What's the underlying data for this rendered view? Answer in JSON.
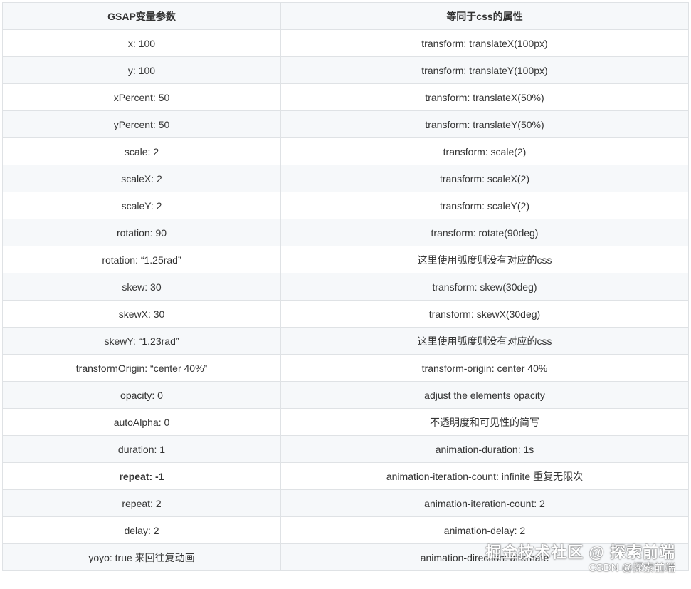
{
  "table": {
    "headers": [
      "GSAP变量参数",
      "等同于css的属性"
    ],
    "rows": [
      {
        "param": "x: 100",
        "css": "transform: translateX(100px)"
      },
      {
        "param": "y: 100",
        "css": "transform: translateY(100px)"
      },
      {
        "param": "xPercent: 50",
        "css": "transform: translateX(50%)"
      },
      {
        "param": "yPercent: 50",
        "css": "transform: translateY(50%)"
      },
      {
        "param": "scale: 2",
        "css": "transform: scale(2)"
      },
      {
        "param": "scaleX: 2",
        "css": "transform: scaleX(2)"
      },
      {
        "param": "scaleY: 2",
        "css": "transform: scaleY(2)"
      },
      {
        "param": "rotation: 90",
        "css": "transform: rotate(90deg)"
      },
      {
        "param": "rotation: “1.25rad”",
        "css": "这里使用弧度则没有对应的css"
      },
      {
        "param": "skew: 30",
        "css": "transform: skew(30deg)"
      },
      {
        "param": "skewX: 30",
        "css": "transform: skewX(30deg)"
      },
      {
        "param": "skewY: “1.23rad”",
        "css": "这里使用弧度则没有对应的css"
      },
      {
        "param": "transformOrigin: “center 40%”",
        "css": "transform-origin: center 40%"
      },
      {
        "param": "opacity: 0",
        "css": "adjust the elements opacity"
      },
      {
        "param": "autoAlpha: 0",
        "css": "不透明度和可见性的简写"
      },
      {
        "param": "duration: 1",
        "css": "animation-duration: 1s"
      },
      {
        "param": "repeat: -1",
        "css": "animation-iteration-count: infinite 重复无限次"
      },
      {
        "param": "repeat: 2",
        "css": "animation-iteration-count: 2"
      },
      {
        "param": "delay: 2",
        "css": "animation-delay: 2"
      },
      {
        "param": "yoyo: true 来回往复动画",
        "css": "animation-direction: alternate"
      }
    ]
  },
  "watermark": {
    "main": "掘金技术社区 @ 探索前端",
    "sub": "CSDN @探索前端"
  },
  "colors": {
    "header_bg": "#f6f8fa",
    "stripe_bg": "#f6f8fa",
    "border": "#dfe2e5",
    "text": "#333333"
  }
}
